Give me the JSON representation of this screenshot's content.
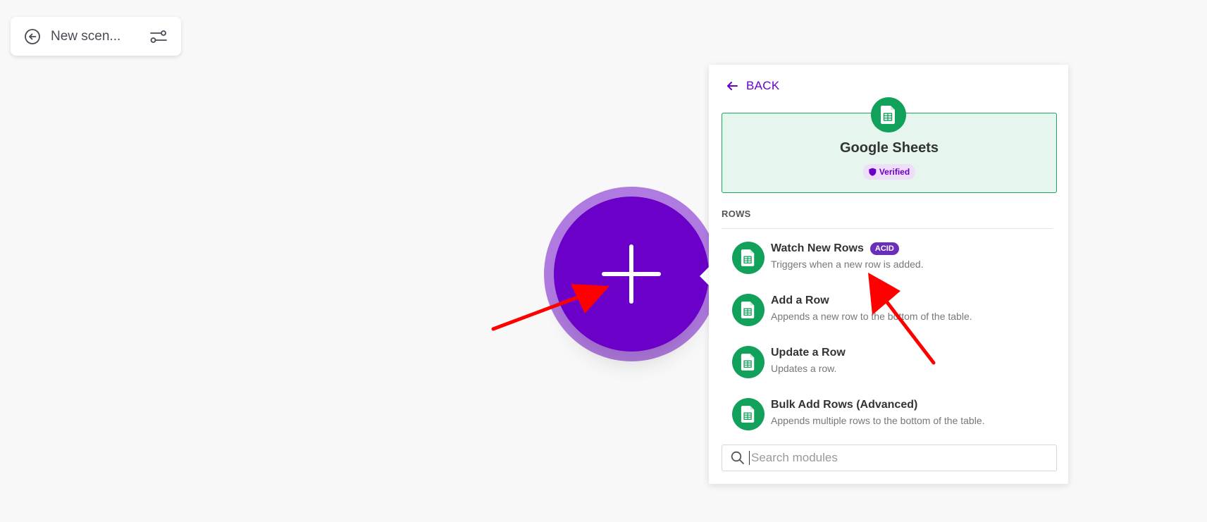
{
  "scenario_header": {
    "title": "New scen...",
    "back_icon": "arrow-circle-left-icon",
    "settings_icon": "sliders-icon"
  },
  "colors": {
    "brand_purple": "#6b00c9",
    "plus_ring": "#b07be0",
    "sheets_green": "#11a15a",
    "card_bg": "#e6f5ed",
    "annotation_red": "#ff0000"
  },
  "panel": {
    "back_label": "BACK",
    "app": {
      "name": "Google Sheets",
      "badge": "Verified",
      "icon": "google-sheets-icon"
    },
    "section_title": "ROWS",
    "modules": [
      {
        "name": "Watch New Rows",
        "badge": "ACID",
        "description": "Triggers when a new row is added."
      },
      {
        "name": "Add a Row",
        "description": "Appends a new row to the bottom of the table."
      },
      {
        "name": "Update a Row",
        "description": "Updates a row."
      },
      {
        "name": "Bulk Add Rows (Advanced)",
        "description": "Appends multiple rows to the bottom of the table."
      }
    ],
    "search": {
      "placeholder": "Search modules",
      "value": ""
    }
  }
}
